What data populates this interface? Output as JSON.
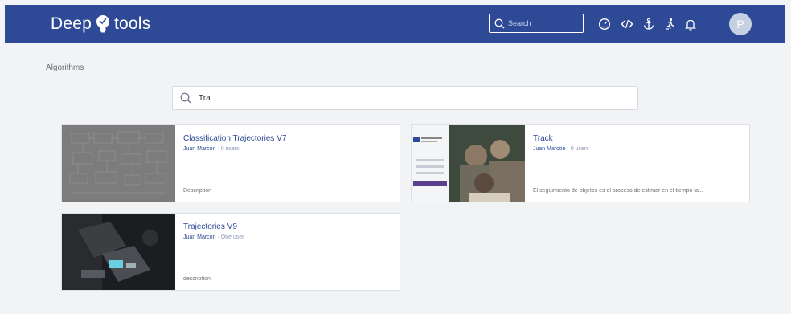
{
  "header": {
    "logo_left": "Deep",
    "logo_right": "tools",
    "search_placeholder": "Search",
    "icons": [
      "dashboard-icon",
      "code-icon",
      "anchor-icon",
      "run-icon",
      "bell-icon"
    ],
    "avatar_initial": "P",
    "bar_color": "#2e4a96"
  },
  "main": {
    "page_title": "Algorithms",
    "search_value": "Tra"
  },
  "cards": [
    {
      "title": "Classification Trajectories V7",
      "author": "Juan Marcon",
      "users": "0 users",
      "description": "Description"
    },
    {
      "title": "Track",
      "author": "Juan Marcon",
      "users": "0 users",
      "description": "El seguimiento de objetos es el proceso de estimar en el tiempo la..."
    },
    {
      "title": "Trajectories V9",
      "author": "Juan Marcon",
      "users": "One user",
      "description": "description"
    }
  ]
}
